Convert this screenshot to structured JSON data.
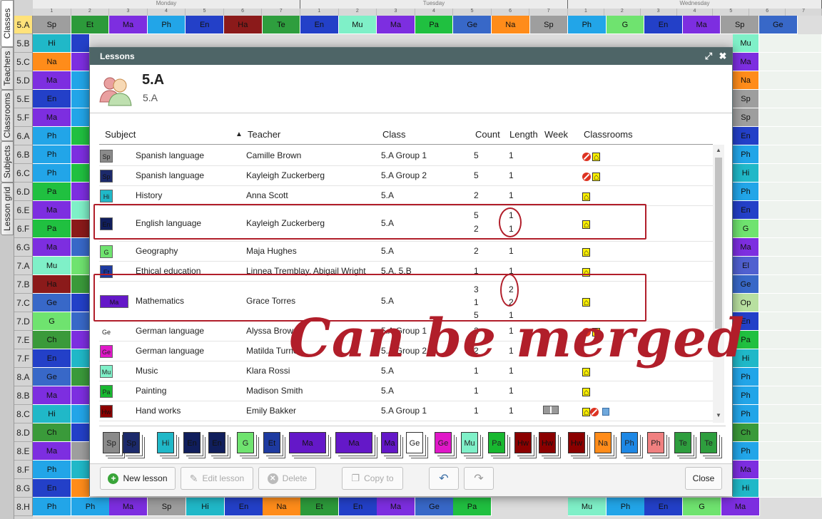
{
  "side_tabs": [
    "Classes",
    "Teachers",
    "Classrooms",
    "Subjects",
    "Lesson grid"
  ],
  "days": [
    "Monday",
    "Tuesday",
    "Wednesday"
  ],
  "periods": [
    "1",
    "2",
    "3",
    "4",
    "5",
    "6",
    "7"
  ],
  "rows": [
    "5.A",
    "5.B",
    "5.C",
    "5.D",
    "5.E",
    "5.F",
    "6.A",
    "6.B",
    "6.C",
    "6.D",
    "6.E",
    "6.F",
    "6.G",
    "7.A",
    "7.B",
    "7.C",
    "7.D",
    "7.E",
    "7.F",
    "8.A",
    "8.B",
    "8.C",
    "8.D",
    "8.E",
    "8.F",
    "8.G",
    "8.H"
  ],
  "top_row_cells": {
    "monday": [
      "Sp",
      "Et",
      "Ma",
      "Ph",
      "En",
      "Ha",
      "Te"
    ],
    "tuesday": [
      "En",
      "Mu",
      "Ma",
      "Pa",
      "Ge",
      "Na",
      "Sp"
    ],
    "wednesday": [
      "Ph",
      "G",
      "En",
      "Ma",
      "Sp",
      "Ge"
    ]
  },
  "left_cells": [
    "Sp",
    "Hi",
    "Na",
    "Ma",
    "En",
    "Ma",
    "Ph",
    "Ph",
    "Ph",
    "Pa",
    "Ma",
    "Pa",
    "Ma",
    "Mu",
    "Ha",
    "Ge",
    "G",
    "Ch",
    "En",
    "Ge",
    "Ma",
    "Hi",
    "Ch",
    "Ma",
    "Ph",
    "En",
    "Ph"
  ],
  "bottom_row_cells": [
    "Ph",
    "Ph",
    "Ma",
    "Sp",
    "Hi",
    "En",
    "Na",
    "Et",
    "En",
    "Ma",
    "Ge",
    "Pa",
    "Mu",
    "Ph",
    "En",
    "G",
    "Ma"
  ],
  "right_cells": [
    "Sp",
    "Mu",
    "Ma",
    "Na",
    "Sp",
    "Sp",
    "En",
    "Ph",
    "Hi",
    "Ph",
    "En",
    "G",
    "Ma",
    "El",
    "Ge",
    "Op",
    "En",
    "Pa",
    "Hi",
    "Ph",
    "Ph",
    "Ph",
    "Ch",
    "Ph",
    "Ma",
    "Hi",
    "Ma"
  ],
  "dialog": {
    "title": "Lessons",
    "header_title": "5.A",
    "header_subtitle": "5.A",
    "columns": {
      "subject": "Subject",
      "sort_indicator": "▲",
      "teacher": "Teacher",
      "class": "Class",
      "count": "Count",
      "length": "Length",
      "week": "Week",
      "classrooms": "Classrooms"
    },
    "lessons": [
      {
        "chip": "Sp",
        "chip_color": "#8a8a8a",
        "subject": "Spanish language",
        "teacher": "Camille Brown",
        "class": "5.A Group 1",
        "count": [
          "5"
        ],
        "length": [
          "1"
        ],
        "classrooms": "no-home"
      },
      {
        "chip": "Sp",
        "chip_color": "#1c2a6b",
        "subject": "Spanish language",
        "teacher": "Kayleigh Zuckerberg",
        "class": "5.A Group 2",
        "count": [
          "5"
        ],
        "length": [
          "1"
        ],
        "classrooms": "no-home"
      },
      {
        "chip": "Hi",
        "chip_color": "#20b8c8",
        "subject": "History",
        "teacher": "Anna Scott",
        "class": "5.A",
        "count": [
          "2"
        ],
        "length": [
          "1"
        ],
        "classrooms": "home"
      },
      {
        "chip": "En",
        "chip_color": "#101e5c",
        "subject": "English language",
        "teacher": "Kayleigh Zuckerberg",
        "class": "5.A",
        "count": [
          "5",
          "2"
        ],
        "length": [
          "1",
          "1"
        ],
        "classrooms": "home"
      },
      {
        "chip": "G",
        "chip_color": "#6fe36f",
        "subject": "Geography",
        "teacher": "Maja Hughes",
        "class": "5.A",
        "count": [
          "2"
        ],
        "length": [
          "1"
        ],
        "classrooms": "home"
      },
      {
        "chip": "Et",
        "chip_color": "#1e3aa0",
        "subject": "Ethical education",
        "teacher": "Linnea Tremblay, Abigail Wright",
        "class": "5.A, 5.B",
        "count": [
          "1"
        ],
        "length": [
          "1"
        ],
        "classrooms": "home"
      },
      {
        "chip": "Ma",
        "chip_color": "#6418c8",
        "subject": "Mathematics",
        "teacher": "Grace Torres",
        "class": "5.A",
        "count": [
          "3",
          "1",
          "5"
        ],
        "length": [
          "2",
          "2",
          "1"
        ],
        "classrooms": "home"
      },
      {
        "chip": "Ge",
        "chip_color": "#ffffff",
        "subject": "German language",
        "teacher": "Alyssa Brown",
        "class": "5.A Group 1",
        "count": [
          "2"
        ],
        "length": [
          "1"
        ],
        "classrooms": "no-home"
      },
      {
        "chip": "Ge",
        "chip_color": "#e018c8",
        "subject": "German language",
        "teacher": "Matilda Turner",
        "class": "5.A Group 2",
        "count": [
          "2"
        ],
        "length": [
          "1"
        ],
        "classrooms": ""
      },
      {
        "chip": "Mu",
        "chip_color": "#7ff0c8",
        "subject": "Music",
        "teacher": "Klara Rossi",
        "class": "5.A",
        "count": [
          "1"
        ],
        "length": [
          "1"
        ],
        "classrooms": "home"
      },
      {
        "chip": "Pa",
        "chip_color": "#18b830",
        "subject": "Painting",
        "teacher": "Madison Smith",
        "class": "5.A",
        "count": [
          "1"
        ],
        "length": [
          "1"
        ],
        "classrooms": "home"
      },
      {
        "chip": "Hw",
        "chip_color": "#8b0000",
        "subject": "Hand works",
        "teacher": "Emily Bakker",
        "class": "5.A Group 1",
        "count": [
          "1"
        ],
        "length": [
          "1"
        ],
        "classrooms": "home-no-flag"
      }
    ],
    "strip_cards": [
      {
        "label": "Sp",
        "color": "#8a8a8a"
      },
      {
        "label": "Sp",
        "color": "#1c2a6b"
      },
      {
        "label": "Hi",
        "color": "#20b8c8"
      },
      {
        "label": "En",
        "color": "#101e5c"
      },
      {
        "label": "En",
        "color": "#101e5c"
      },
      {
        "label": "G",
        "color": "#6fe36f"
      },
      {
        "label": "Et",
        "color": "#1e3aa0"
      },
      {
        "label": "Ma",
        "color": "#6418c8"
      },
      {
        "label": "Ma",
        "color": "#6418c8"
      },
      {
        "label": "Ma",
        "color": "#6418c8"
      },
      {
        "label": "Ge",
        "color": "#ffffff"
      },
      {
        "label": "Ge",
        "color": "#e018c8"
      },
      {
        "label": "Mu",
        "color": "#7ff0c8"
      },
      {
        "label": "Pa",
        "color": "#18b830"
      },
      {
        "label": "Hw",
        "color": "#8b0000"
      },
      {
        "label": "Hw",
        "color": "#8b0000"
      },
      {
        "label": "Hw",
        "color": "#8b0000"
      },
      {
        "label": "Na",
        "color": "#ff8c1a"
      },
      {
        "label": "Ph",
        "color": "#1e88e5"
      },
      {
        "label": "Ph",
        "color": "#f08080"
      },
      {
        "label": "Te",
        "color": "#2e9e3e"
      },
      {
        "label": "Te",
        "color": "#2e9e3e"
      }
    ],
    "buttons": {
      "new_lesson": "New lesson",
      "edit_lesson": "Edit lesson",
      "delete": "Delete",
      "copy_to": "Copy to",
      "close": "Close"
    }
  },
  "annotation": {
    "text": "Can be merged",
    "color": "#b11e2a"
  }
}
